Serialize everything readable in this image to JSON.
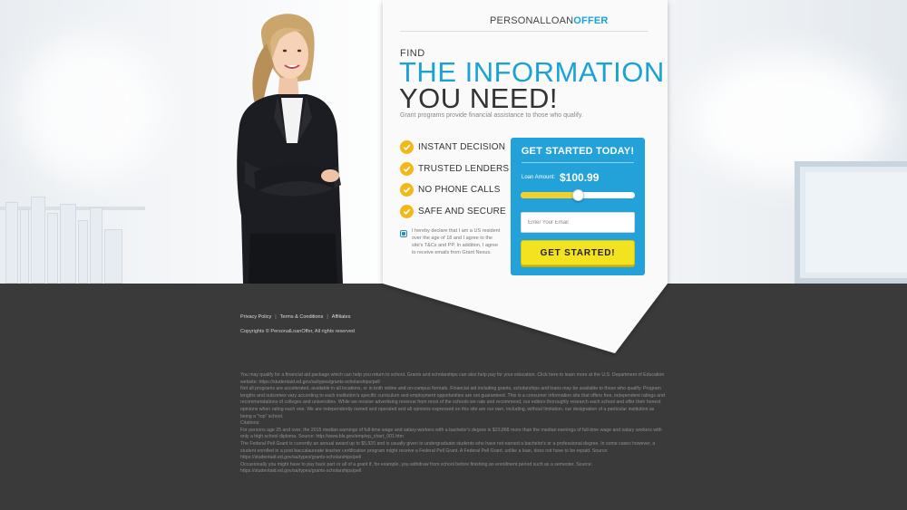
{
  "brand": {
    "logo_part1": "PERSONALLOAN",
    "logo_part2": "OFFER",
    "accent_color": "#1aa2d6"
  },
  "hero": {
    "eyebrow": "FIND",
    "headline_line1": "THE INFORMATION",
    "headline_line2": "YOU NEED!",
    "subtitle": "Grant programs provide financial assistance to those who qualify."
  },
  "features": [
    {
      "label": "INSTANT DECISION",
      "icon": "checkmark-icon"
    },
    {
      "label": "TRUSTED LENDERS",
      "icon": "checkmark-icon"
    },
    {
      "label": "NO PHONE CALLS",
      "icon": "checkmark-icon"
    },
    {
      "label": "SAFE AND SECURE",
      "icon": "checkmark-icon"
    }
  ],
  "consent": {
    "checked": true,
    "text": "I hereby declare that I am a US resident over the age of 18 and I agree to the site's T&Cs and PP. In addition, I agree to receive emails from Grant Nexus."
  },
  "form": {
    "title": "GET STARTED TODAY!",
    "amount_label": "Loan Amount:",
    "amount_value": "$100.99",
    "slider_level_percent": 50,
    "email_placeholder": "Enter Your Email",
    "submit_label": "GET STARTED!",
    "card_color": "#22a2d8",
    "button_color": "#f3e21f"
  },
  "footer": {
    "links": [
      "Privacy Policy",
      "Terms & Conditions",
      "Affiliates"
    ],
    "separator": "|",
    "copyright": "Copyrights © PersonalLoanOffer, All rights reserved",
    "disclaimer": [
      "You may qualify for a financial aid package which can help you return to school. Grants and scholarships can also help pay for your education. Click here to learn more at the U.S. Department of Education website: https://studentaid.ed.gov/sa/types/grants-scholarships/pell",
      "Not all programs are accelerated, available in all locations, or in both online and on-campus formats. Financial aid including grants, scholarships and loans may be available to those who qualify. Program lengths and outcomes vary according to each institution's specific curriculum and employment opportunities are not guaranteed. This is a consumer information site that offers free, independent ratings and recommendations of colleges and universities. While we receive advertising revenue from most of the schools we rate and recommend, our editors thoroughly research each school and offer their honest opinions when rating each one. We are independently owned and operated and all opinions expressed on this site are our own, including, without limitation, our designation of a particular institution as being a \"top\" school.",
      "Citations:",
      "For persons age 25 and over, the 2015 median earnings of full-time wage and salary-workers with a bachelor's degree is $23,868 more than the median earnings of full-time wage and salary workers with only a high school diploma. Source: http://www.bls.gov/emp/ep_chart_001.htm",
      "The Federal Pell Grant is currently an annual award up to $5,920 and is usually given to undergraduate students who have not earned a bachelor's or a professional degree. In some cases however, a student enrolled in a post baccalaureate teacher certification program might receive a Federal Pell Grant. A Federal Pell Grant, unlike a loan, does not have to be repaid. Source: https://studentaid.ed.gov/sa/types/grants-scholarships/pell",
      "Occasionally you might have to pay back part or all of a grant if, for example, you withdraw from school before finishing an enrollment period such as a semester. Source: https://studentaid.ed.gov/sa/types/grants-scholarships/pell"
    ]
  }
}
